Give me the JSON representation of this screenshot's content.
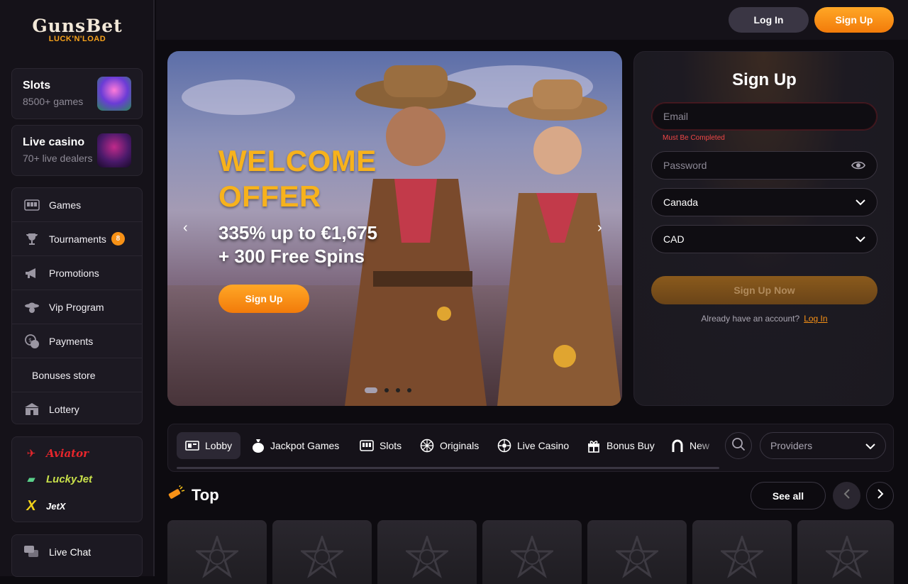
{
  "brand": {
    "name": "GunsBet",
    "tagline": "LUCK'N'LOAD"
  },
  "header": {
    "login_label": "Log In",
    "signup_label": "Sign Up"
  },
  "sidebar": {
    "categories": [
      {
        "title": "Slots",
        "subtitle": "8500+ games"
      },
      {
        "title": "Live casino",
        "subtitle": "70+ live dealers"
      }
    ],
    "nav": [
      {
        "label": "Games",
        "icon": "games-icon"
      },
      {
        "label": "Tournaments",
        "icon": "trophy-icon",
        "badge": "8"
      },
      {
        "label": "Promotions",
        "icon": "megaphone-icon"
      },
      {
        "label": "Vip Program",
        "icon": "vip-icon"
      },
      {
        "label": "Payments",
        "icon": "payments-icon"
      },
      {
        "label": "Bonuses store"
      },
      {
        "label": "Lottery",
        "icon": "lottery-icon"
      }
    ],
    "games": [
      {
        "label": "Aviator",
        "color": "#e8262c"
      },
      {
        "label": "LuckyJet",
        "color": "#c8e04a"
      },
      {
        "label": "JetX",
        "color": "#ffffff"
      }
    ],
    "chat_label": "Live Chat"
  },
  "hero": {
    "title_line1": "WELCOME",
    "title_line2": "OFFER",
    "sub_line1": "335% up to €1,675",
    "sub_line2": "+ 300 Free Spins",
    "button_label": "Sign Up",
    "slides": 4,
    "active_slide": 1
  },
  "signup_form": {
    "title": "Sign Up",
    "email_placeholder": "Email",
    "email_error": "Must Be Completed",
    "password_placeholder": "Password",
    "country_value": "Canada",
    "currency_value": "CAD",
    "submit_label": "Sign Up Now",
    "already_text": "Already have an account?",
    "login_link": "Log In"
  },
  "tabs": [
    {
      "label": "Lobby",
      "icon": "lobby-icon",
      "active": true
    },
    {
      "label": "Jackpot Games",
      "icon": "moneybag-icon"
    },
    {
      "label": "Slots",
      "icon": "slots-icon"
    },
    {
      "label": "Originals",
      "icon": "wheel-icon"
    },
    {
      "label": "Live Casino",
      "icon": "roulette-icon"
    },
    {
      "label": "Bonus Buy",
      "icon": "gift-icon"
    },
    {
      "label": "New",
      "icon": "horseshoe-icon"
    }
  ],
  "providers_label": "Providers",
  "top_section": {
    "title": "Top",
    "see_all": "See all",
    "tile_count": 7
  },
  "colors": {
    "accent": "#f79116",
    "background": "#0d0b10",
    "sidebar": "#151219"
  }
}
